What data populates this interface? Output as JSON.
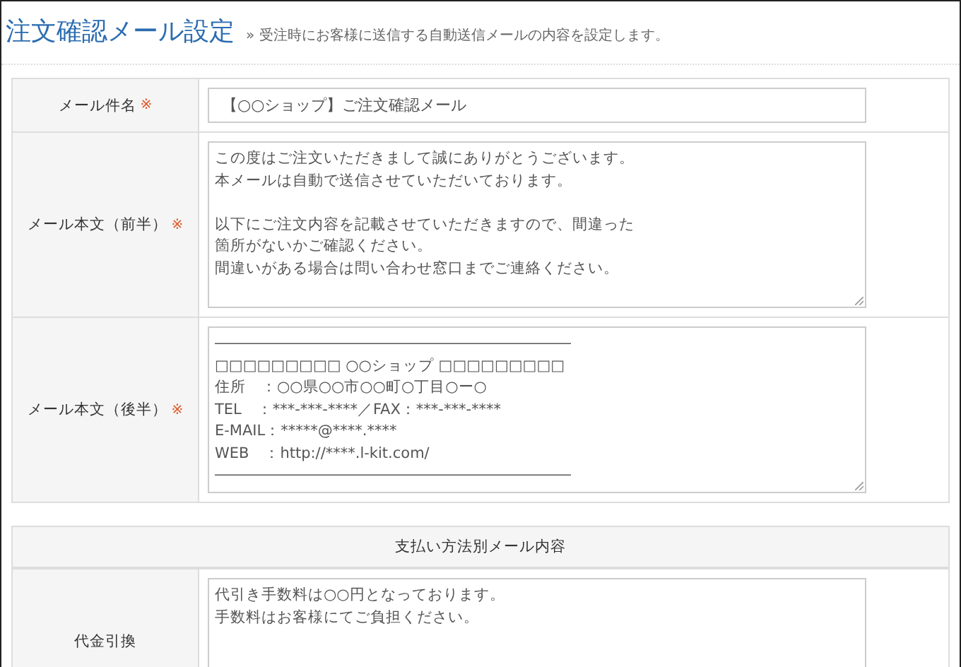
{
  "page": {
    "title": "注文確認メール設定",
    "subtitle_mark": "»",
    "subtitle": "受注時にお客様に送信する自動送信メールの内容を設定します。"
  },
  "form_rows": [
    {
      "kind": "input",
      "label": "メール件名",
      "required_mark": "※",
      "value": "【○○ショップ】ご注文確認メール"
    },
    {
      "kind": "textarea",
      "label": "メール本文（前半）",
      "required_mark": "※",
      "paragraphs": [
        [
          "この度はご注文いただきまして誠にありがとうございます。",
          "本メールは自動で送信させていただいております。"
        ],
        [
          "以下にご注文内容を記載させていただきますので、間違った",
          "箇所がないかご確認ください。",
          "間違いがある場合は問い合わせ窓口までご連絡ください。"
        ]
      ]
    },
    {
      "kind": "textarea",
      "label": "メール本文（後半）",
      "required_mark": "※",
      "paragraphs": [
        [
          "――――――――――――――――――――――――",
          "□□□□□□□□□ ○○ショップ □□□□□□□□□",
          "住所　：○○県○○市○○町○丁目○ー○",
          "TEL　：***-***-****／FAX：***-***-****",
          "E-MAIL：*****@****.****",
          "WEB　：http://****.l-kit.com/",
          "――――――――――――――――――――――――"
        ]
      ]
    }
  ],
  "payment_section": {
    "heading": "支払い方法別メール内容",
    "rows": [
      {
        "kind": "textarea",
        "label": "代金引換",
        "paragraphs": [
          [
            "代引き手数料は○○円となっております。",
            "手数料はお客様にてご負担ください。"
          ]
        ]
      }
    ]
  }
}
